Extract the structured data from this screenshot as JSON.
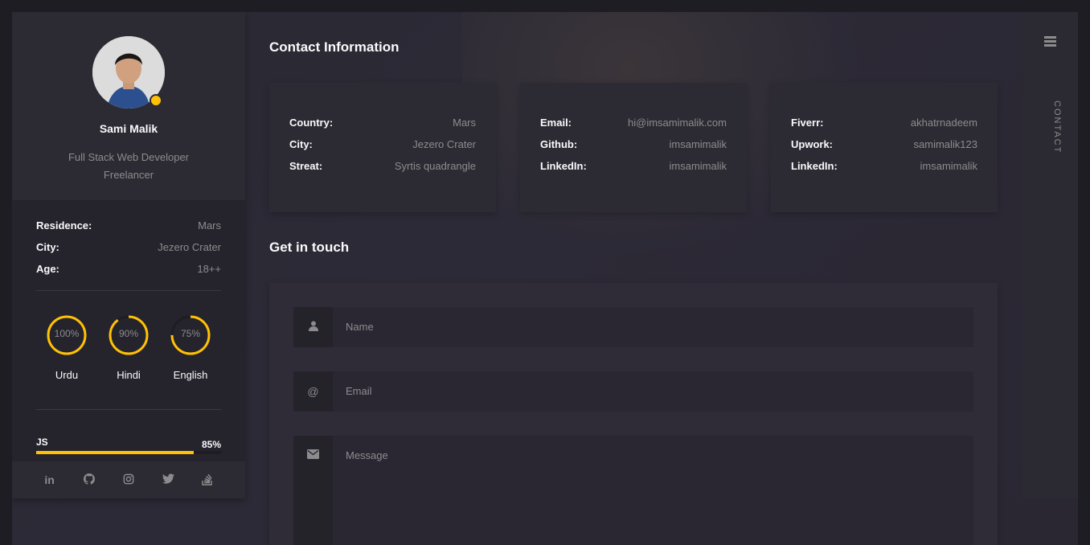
{
  "profile": {
    "name": "Sami Malik",
    "role_line1": "Full Stack Web Developer",
    "role_line2": "Freelancer",
    "status_color": "#ffc107"
  },
  "personal": [
    {
      "label": "Residence:",
      "value": "Mars"
    },
    {
      "label": "City:",
      "value": "Jezero Crater"
    },
    {
      "label": "Age:",
      "value": "18++"
    }
  ],
  "languages": [
    {
      "name": "Urdu",
      "percent_label": "100%",
      "level": 1.0
    },
    {
      "name": "Hindi",
      "percent_label": "90%",
      "level": 0.9
    },
    {
      "name": "English",
      "percent_label": "75%",
      "level": 0.75
    }
  ],
  "skills": [
    {
      "name": "JS",
      "percent_label": "85%",
      "level": 0.85
    }
  ],
  "social_icons": [
    "linkedin-icon",
    "github-icon",
    "instagram-icon",
    "twitter-icon",
    "stackoverflow-icon"
  ],
  "contact": {
    "title": "Contact Information",
    "cards": [
      {
        "rows": [
          {
            "label": "Country:",
            "value": "Mars"
          },
          {
            "label": "City:",
            "value": "Jezero Crater"
          },
          {
            "label": "Streat:",
            "value": "Syrtis quadrangle"
          }
        ]
      },
      {
        "rows": [
          {
            "label": "Email:",
            "value": "hi@imsamimalik.com"
          },
          {
            "label": "Github:",
            "value": "imsamimalik"
          },
          {
            "label": "LinkedIn:",
            "value": "imsamimalik"
          }
        ]
      },
      {
        "rows": [
          {
            "label": "Fiverr:",
            "value": "akhatrnadeem"
          },
          {
            "label": "Upwork:",
            "value": "samimalik123"
          },
          {
            "label": "LinkedIn:",
            "value": "imsamimalik"
          }
        ]
      }
    ]
  },
  "form": {
    "title": "Get in touch",
    "name_placeholder": "Name",
    "email_placeholder": "Email",
    "message_placeholder": "Message",
    "name_icon": "user-icon",
    "email_icon": "at-icon",
    "message_icon": "envelope-icon"
  },
  "nav": {
    "current_label": "CONTACT",
    "menu_icon": "hamburger-icon"
  },
  "colors": {
    "accent": "#ffc107",
    "background": "#1e1d24",
    "panel": "#2c2b33",
    "muted_text": "#8c8c8e"
  }
}
